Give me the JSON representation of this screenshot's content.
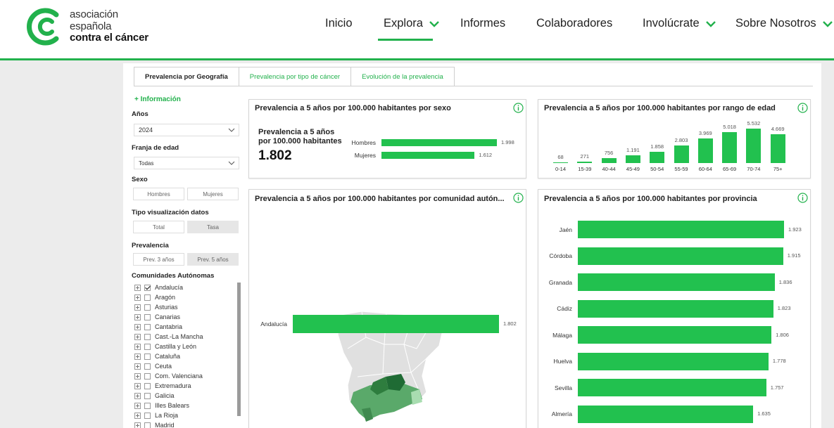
{
  "header": {
    "logo_line1": "asociación",
    "logo_line2": "española",
    "logo_line3": "contra el cáncer",
    "nav": [
      {
        "label": "Inicio",
        "dropdown": false,
        "active": false
      },
      {
        "label": "Explora",
        "dropdown": true,
        "active": true
      },
      {
        "label": "Informes",
        "dropdown": false,
        "active": false
      },
      {
        "label": "Colaboradores",
        "dropdown": false,
        "active": false
      },
      {
        "label": "Involúcrate",
        "dropdown": true,
        "active": false
      },
      {
        "label": "Sobre Nosotros",
        "dropdown": true,
        "active": false
      }
    ]
  },
  "tabs": [
    {
      "label": "Prevalencia por Geografía",
      "active": true
    },
    {
      "label": "Prevalencia por tipo de cáncer",
      "active": false
    },
    {
      "label": "Evolución de la prevalencia",
      "active": false
    }
  ],
  "filters": {
    "info_link": "+ Información",
    "years_label": "Años",
    "years_value": "2024",
    "age_label": "Franja de edad",
    "age_value": "Todas",
    "sex_label": "Sexo",
    "sex_options": [
      {
        "label": "Hombres",
        "selected": false
      },
      {
        "label": "Mujeres",
        "selected": false
      }
    ],
    "vis_label": "Tipo visualización datos",
    "vis_options": [
      {
        "label": "Total",
        "selected": false
      },
      {
        "label": "Tasa",
        "selected": true
      }
    ],
    "prev_label": "Prevalencia",
    "prev_options": [
      {
        "label": "Prev. 3 años",
        "selected": false
      },
      {
        "label": "Prev. 5 años",
        "selected": true
      }
    ],
    "ccaa_label": "Comunidades Autónomas",
    "ccaa": [
      {
        "label": "Andalucía",
        "checked": true
      },
      {
        "label": "Aragón",
        "checked": false
      },
      {
        "label": "Asturias",
        "checked": false
      },
      {
        "label": "Canarias",
        "checked": false
      },
      {
        "label": "Cantabria",
        "checked": false
      },
      {
        "label": "Cast.-La Mancha",
        "checked": false
      },
      {
        "label": "Castilla y León",
        "checked": false
      },
      {
        "label": "Cataluña",
        "checked": false
      },
      {
        "label": "Ceuta",
        "checked": false
      },
      {
        "label": "Com. Valenciana",
        "checked": false
      },
      {
        "label": "Extremadura",
        "checked": false
      },
      {
        "label": "Galicia",
        "checked": false
      },
      {
        "label": "Illes Balears",
        "checked": false
      },
      {
        "label": "La Rioja",
        "checked": false
      },
      {
        "label": "Madrid",
        "checked": false
      }
    ]
  },
  "cards": {
    "sex": {
      "title": "Prevalencia a 5 años por 100.000 habitantes por sexo",
      "kpi_label_1": "Prevalencia a 5 años",
      "kpi_label_2": "por 100.000 habitantes",
      "kpi_value": "1.802"
    },
    "age": {
      "title": "Prevalencia a 5 años por 100.000 habitantes por rango de edad"
    },
    "community": {
      "title": "Prevalencia a 5 años por 100.000 habitantes por comunidad autón..."
    },
    "province": {
      "title": "Prevalencia a 5 años por 100.000 habitantes por provincia"
    }
  },
  "colors": {
    "accent": "#22c14f",
    "brand": "#22b14c",
    "map_base": "#e0e0e0"
  },
  "chart_data": [
    {
      "type": "bar",
      "orientation": "horizontal",
      "title": "Prevalencia a 5 años por 100.000 habitantes por sexo",
      "categories": [
        "Hombres",
        "Mujeres"
      ],
      "values": [
        1998,
        1612
      ],
      "labels": [
        "1.998",
        "1.612"
      ],
      "xlim": [
        0,
        1998
      ]
    },
    {
      "type": "bar",
      "orientation": "vertical",
      "title": "Prevalencia a 5 años por 100.000 habitantes por rango de edad",
      "categories": [
        "0-14",
        "15-39",
        "40-44",
        "45-49",
        "50-54",
        "55-59",
        "60-64",
        "65-69",
        "70-74",
        "75+"
      ],
      "values": [
        68,
        271,
        756,
        1191,
        1858,
        2803,
        3969,
        5018,
        5532,
        4669
      ],
      "labels": [
        "68",
        "271",
        "756",
        "1.191",
        "1.858",
        "2.803",
        "3.969",
        "5.018",
        "5.532",
        "4.669"
      ],
      "ylim": [
        0,
        5532
      ]
    },
    {
      "type": "bar",
      "orientation": "horizontal",
      "title": "Prevalencia a 5 años por 100.000 habitantes por comunidad autón...",
      "categories": [
        "Andalucía"
      ],
      "values": [
        1802
      ],
      "labels": [
        "1.802"
      ],
      "xlim": [
        0,
        1802
      ]
    },
    {
      "type": "bar",
      "orientation": "horizontal",
      "title": "Prevalencia a 5 años por 100.000 habitantes por provincia",
      "categories": [
        "Jaén",
        "Córdoba",
        "Granada",
        "Cádiz",
        "Málaga",
        "Huelva",
        "Sevilla",
        "Almería"
      ],
      "values": [
        1923,
        1915,
        1836,
        1823,
        1806,
        1778,
        1757,
        1635
      ],
      "labels": [
        "1.923",
        "1.915",
        "1.836",
        "1.823",
        "1.806",
        "1.778",
        "1.757",
        "1.635"
      ],
      "xlim": [
        0,
        1923
      ]
    }
  ]
}
